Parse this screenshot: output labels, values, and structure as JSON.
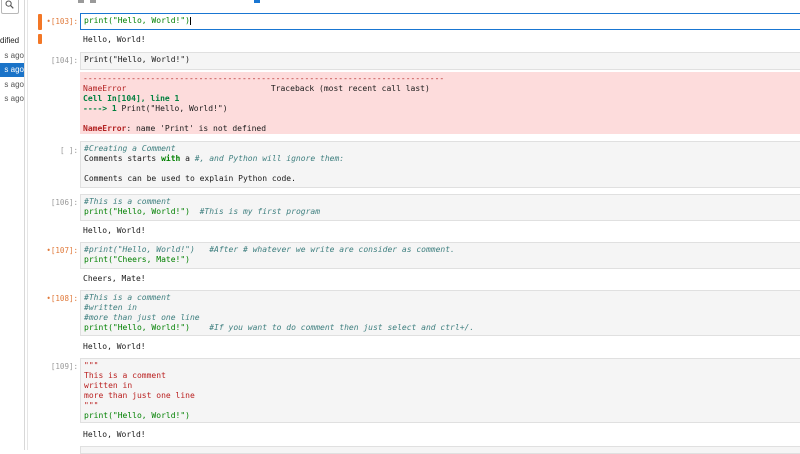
{
  "file_browser": {
    "header": "dified",
    "rows": [
      "s ago",
      "s ago",
      "s ago",
      "s ago"
    ],
    "selected_index": 1
  },
  "cells": [
    {
      "prompt": "[103]:",
      "code": "print(\"Hello, World!\")",
      "output": "Hello, World!"
    },
    {
      "prompt": "[104]:",
      "code": "Print(\"Hello, World!\")",
      "error": {
        "dashes": "---------------------------------------------------------------------------",
        "name": "NameError",
        "traceback_label": "Traceback (most recent call last)",
        "cell_ref": "Cell In[104], line 1",
        "arrow": "----> 1",
        "arrow_code": "Print(\"Hello, World!\")",
        "final_name": "NameError",
        "message": ": name 'Print' is not defined"
      }
    },
    {
      "prompt": "[ ]:",
      "md_comment": "#Creating a Comment",
      "md_line_a": "Comments starts ",
      "md_with": "with",
      "md_line_b": " a ",
      "md_line_c": "#, and Python will ignore them:",
      "md_line_d": "Comments can be used to explain Python code."
    },
    {
      "prompt": "[106]:",
      "comment": "#This is a comment",
      "code": "print(\"Hello, World!\")",
      "inline_comment": "#This is my first program",
      "output": "Hello, World!"
    },
    {
      "prompt": "[107]:",
      "line1_code": "#print(\"Hello, World!\")",
      "line1_comment": "#After # whatever we write are consider as comment.",
      "code": "print(\"Cheers, Mate!\")",
      "output": "Cheers, Mate!"
    },
    {
      "prompt": "[108]:",
      "comment1": "#This is a comment",
      "comment2": "#written in",
      "comment3": "#more than just one line",
      "code": "print(\"Hello, World!\")",
      "inline_comment": "#If you want to do comment then just select and ctrl+/.",
      "output": "Hello, World!"
    },
    {
      "prompt": "[109]:",
      "doc1": "\"\"\"",
      "doc2": "This is a comment",
      "doc3": "written in",
      "doc4": "more than just one line",
      "doc5": "\"\"\"",
      "code": "print(\"Hello, World!\")",
      "output": "Hello, World!"
    }
  ]
}
